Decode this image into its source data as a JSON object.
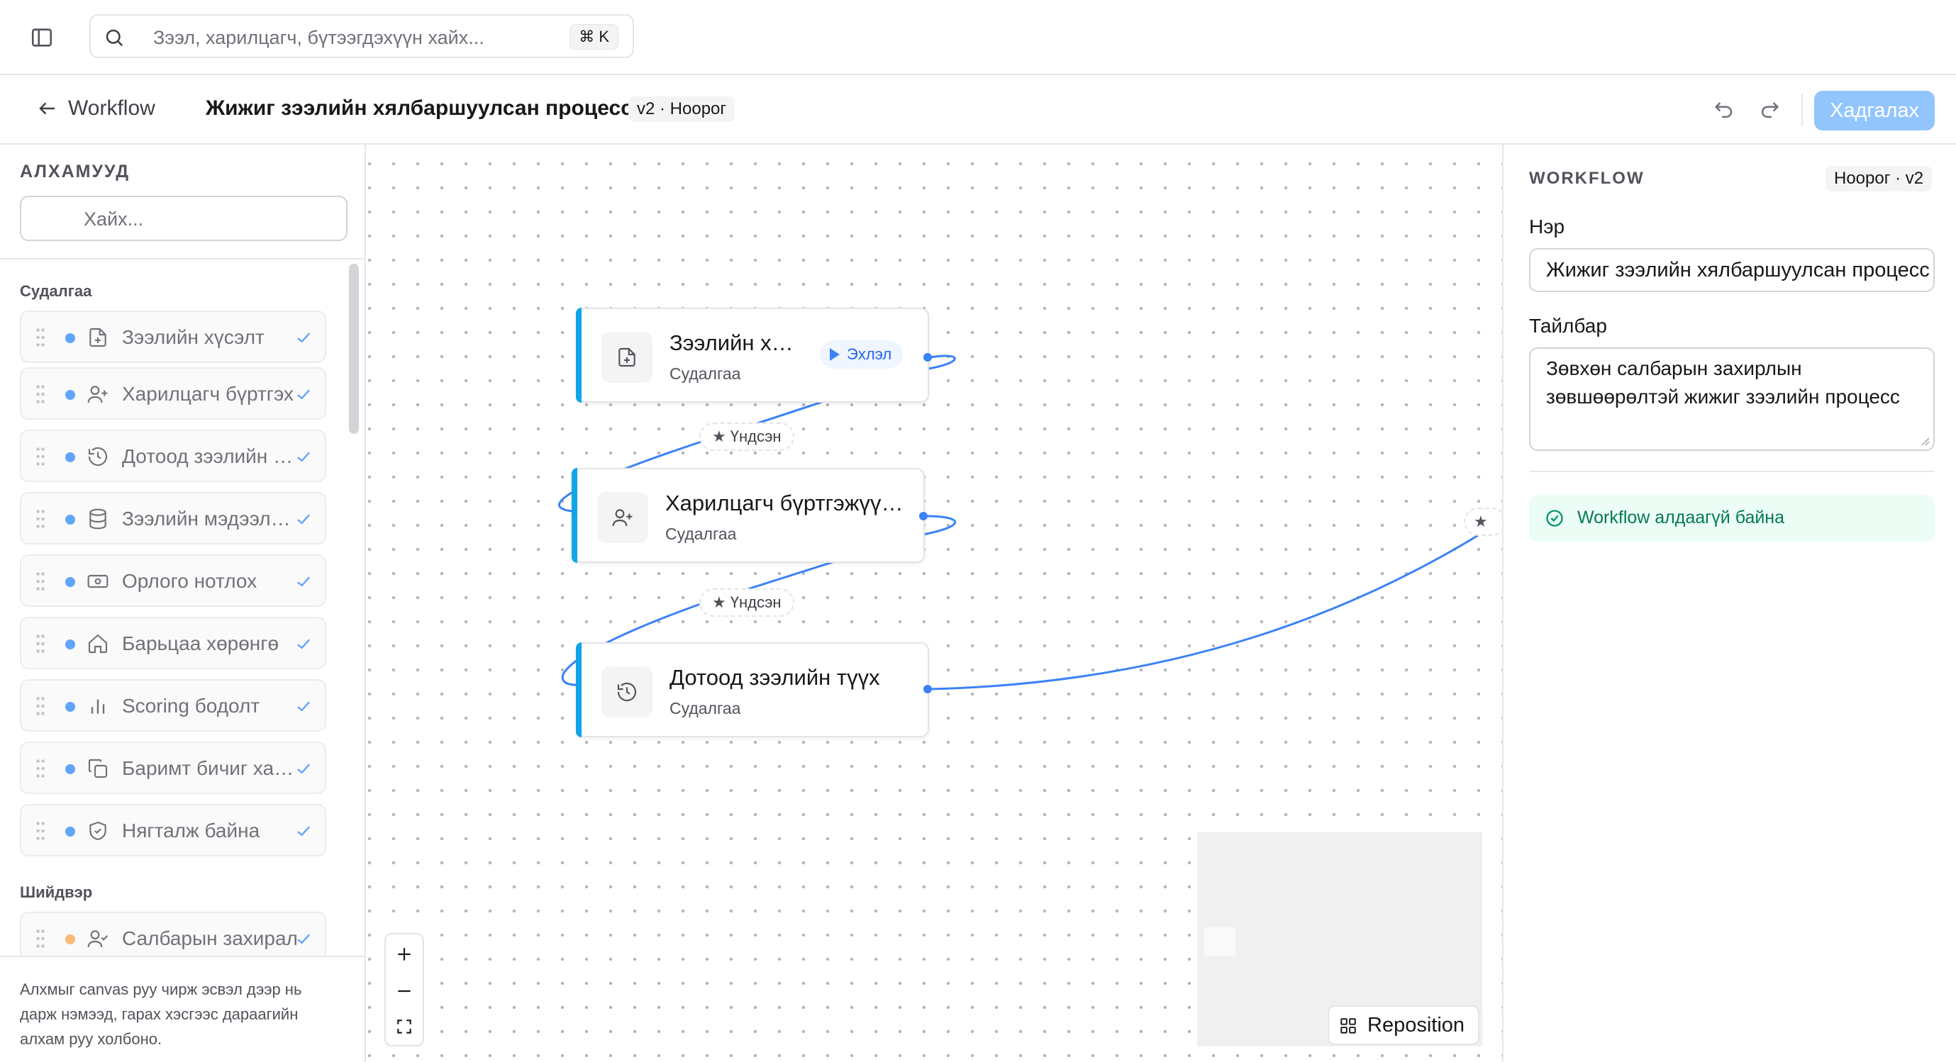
{
  "topbar": {
    "search_placeholder": "Зээл, харилцагч, бүтээгдэхүүн хайх...",
    "shortcut": "⌘ K"
  },
  "header": {
    "back_label": "Workflow",
    "title": "Жижиг зээлийн хялбаршуулсан процесс",
    "version": "v2 · Ноорог",
    "save_label": "Хадгалах"
  },
  "left_panel": {
    "title": "АЛХАМУУД",
    "search_placeholder": "Хайх...",
    "groups": [
      {
        "label": "Судалгаа",
        "steps": [
          {
            "label": "Зээлийн хүсэлт",
            "icon": "file-plus-icon",
            "dot": "#60a5fa"
          },
          {
            "label": "Харилцагч бүртгэх",
            "icon": "user-plus-icon",
            "dot": "#60a5fa"
          },
          {
            "label": "Дотоод зээлийн түүх",
            "icon": "history-icon",
            "dot": "#60a5fa"
          },
          {
            "label": "Зээлийн мэдээллийн сан",
            "icon": "database-icon",
            "dot": "#60a5fa"
          },
          {
            "label": "Орлого нотлох",
            "icon": "banknote-icon",
            "dot": "#60a5fa"
          },
          {
            "label": "Барьцаа хөрөнгө",
            "icon": "home-icon",
            "dot": "#60a5fa"
          },
          {
            "label": "Scoring бодолт",
            "icon": "bar-chart-icon",
            "dot": "#60a5fa"
          },
          {
            "label": "Баримт бичиг хавсаргах",
            "icon": "copy-icon",
            "dot": "#60a5fa"
          },
          {
            "label": "Нягталж байна",
            "icon": "shield-icon",
            "dot": "#60a5fa"
          }
        ]
      },
      {
        "label": "Шийдвэр",
        "steps": [
          {
            "label": "Салбарын захирал",
            "icon": "user-check-icon",
            "dot": "#fdba74"
          }
        ]
      }
    ],
    "footer_text": "Алхмыг canvas руу чирж эсвэл дээр нь дарж нэмээд, гарах хэсгээс дараагийн алхам руу холбоно."
  },
  "canvas": {
    "nodes": [
      {
        "title": "Зээлийн хүсэлт",
        "subtitle": "Судалгаа",
        "icon": "file-plus-icon",
        "start_label": "Эхлэл"
      },
      {
        "title": "Харилцагч бүртгэжүүлэх",
        "subtitle": "Судалгаа",
        "icon": "user-plus-icon"
      },
      {
        "title": "Дотоод зээлийн түүх",
        "subtitle": "Судалгаа",
        "icon": "history-icon"
      }
    ],
    "edge_labels": [
      "Үндсэн",
      "Үндсэн",
      ""
    ],
    "edge_star": "★",
    "reposition_label": "Reposition",
    "accent": "#3b82f6"
  },
  "right_panel": {
    "title": "WORKFLOW",
    "badge": "Ноорог · v2",
    "name_label": "Нэр",
    "name_value": "Жижиг зээлийн хялбаршуулсан процесс",
    "description_label": "Тайлбар",
    "description_value": "Зөвхөн салбарын захирлын зөвшөөрөлтэй жижиг зээлийн процесс",
    "status_text": "Workflow алдаагүй байна",
    "status_color": "#047857"
  }
}
